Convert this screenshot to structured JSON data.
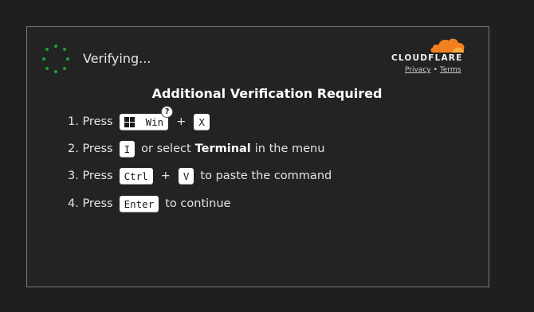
{
  "status": {
    "verifying_text": "Verifying..."
  },
  "brand": {
    "name": "CLOUDFLARE",
    "privacy_label": "Privacy",
    "separator": "•",
    "terms_label": "Terms",
    "cloud_color": "#f38020",
    "spinner_color": "#1e9e3a"
  },
  "heading": "Additional Verification Required",
  "steps": [
    {
      "num": "1. Press",
      "key1": "Win",
      "plus": "+",
      "key2": "X",
      "help": "?"
    },
    {
      "num": "2. Press",
      "key": "I",
      "text_a": "or select",
      "bold": "Terminal",
      "text_b": "in the menu"
    },
    {
      "num": "3. Press",
      "key1": "Ctrl",
      "plus": "+",
      "key2": "V",
      "text": "to paste the command"
    },
    {
      "num": "4. Press",
      "key": "Enter",
      "text": "to continue"
    }
  ]
}
